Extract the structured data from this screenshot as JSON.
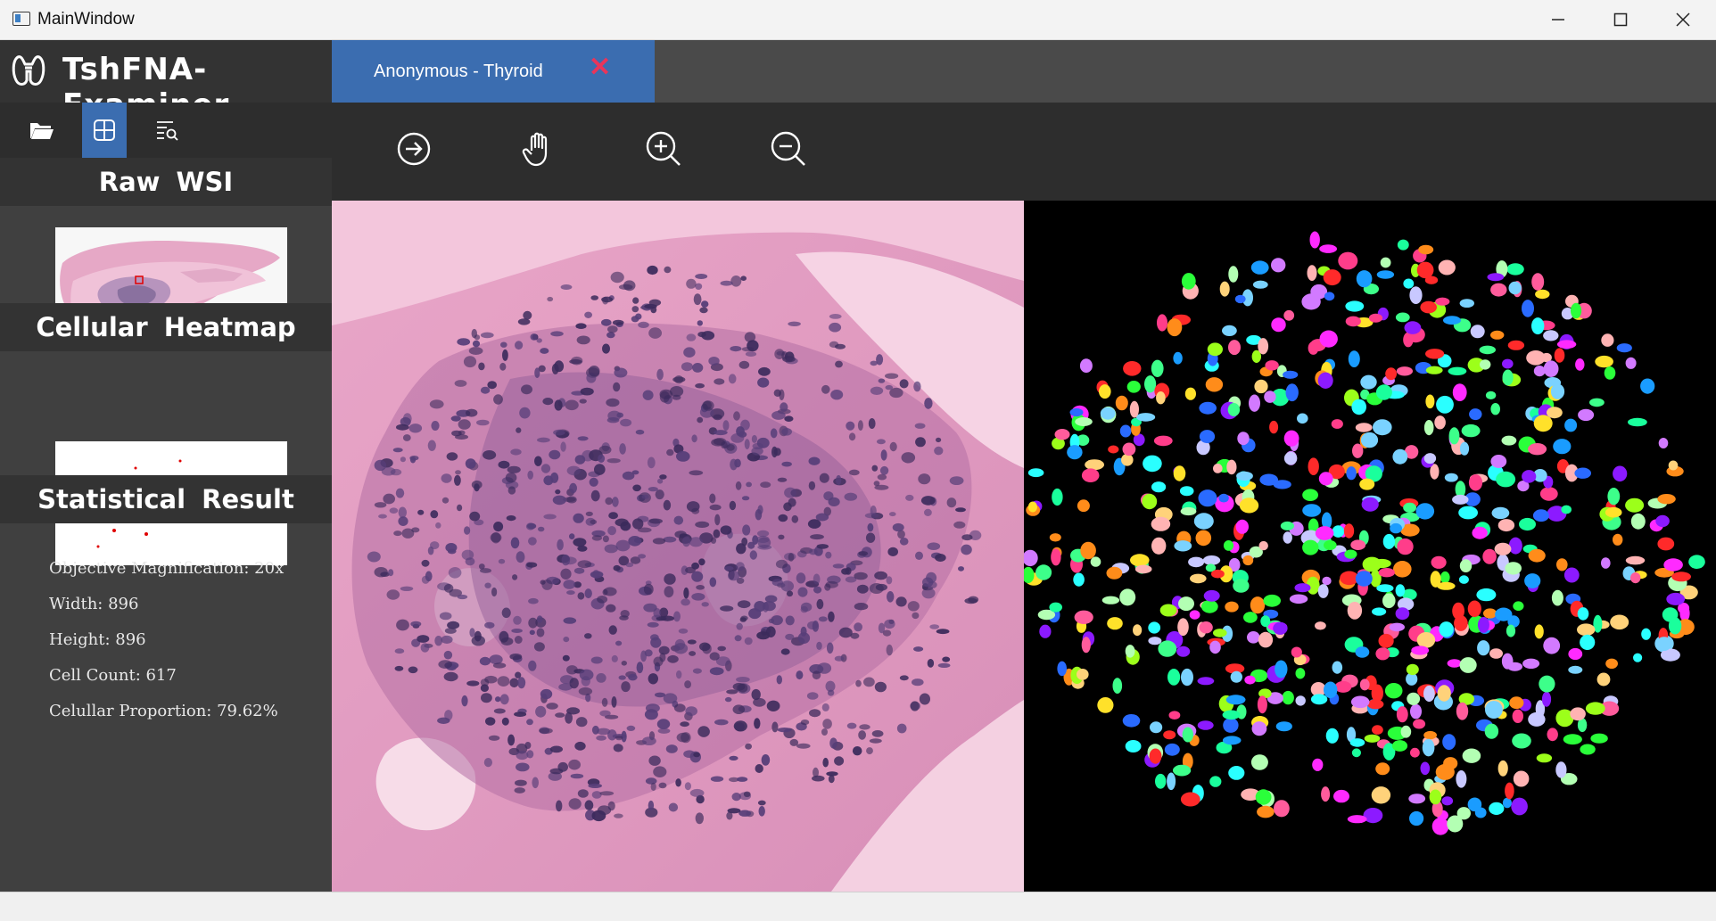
{
  "window": {
    "title": "MainWindow",
    "minimize_label": "—",
    "maximize_label": "☐",
    "close_label": "✕"
  },
  "app": {
    "name": "TshFNA-Examiner",
    "tab_label": "Anonymous - Thyroid",
    "tab_close": "✕"
  },
  "sidebar": {
    "tools": [
      "folder-open-icon",
      "grid-icon",
      "list-search-icon"
    ],
    "active_tool": 1,
    "raw_wsi_title": "Raw WSI",
    "heatmap_title": "Cellular Heatmap",
    "stats_title": "Statistical Result",
    "stats": [
      "Objective Magnification: 20x",
      "Width: 896",
      "Height: 896",
      "Cell Count: 617",
      "Celullar Proportion: 79.62%"
    ]
  },
  "toolbar": {
    "tools": [
      "arrow-right-circle-icon",
      "hand-pan-icon",
      "zoom-in-icon",
      "zoom-out-icon"
    ]
  },
  "colors": {
    "accent": "#3b6db0",
    "close_red": "#e9355a",
    "header_bg": "#333333",
    "panel_bg": "#404040"
  }
}
